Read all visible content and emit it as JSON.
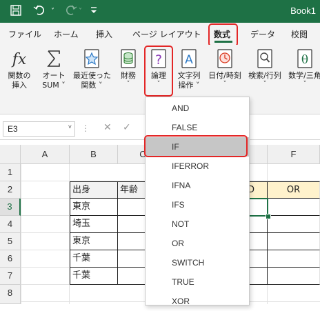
{
  "titlebar": {
    "title": "Book1",
    "save_icon": "save-icon",
    "undo_icon": "undo-icon",
    "redo_icon": "redo-icon",
    "customize_icon": "customize-qat-icon"
  },
  "menu": {
    "tabs": [
      "ファイル",
      "ホーム",
      "挿入",
      "ページ レイアウト",
      "数式",
      "データ",
      "校閲"
    ],
    "active": "数式"
  },
  "ribbon": {
    "buttons": [
      {
        "line1": "関数の",
        "line2": "挿入",
        "caret": "",
        "icon": "fx-icon"
      },
      {
        "line1": "オート",
        "line2": "SUM",
        "caret": "˅",
        "icon": "sigma-icon"
      },
      {
        "line1": "最近使った",
        "line2": "関数",
        "caret": "˅",
        "icon": "star-book-icon"
      },
      {
        "line1": "財務",
        "line2": "",
        "caret": "˅",
        "icon": "database-book-icon"
      },
      {
        "line1": "論理",
        "line2": "",
        "caret": "˅",
        "icon": "question-book-icon"
      },
      {
        "line1": "文字列",
        "line2": "操作",
        "caret": "˅",
        "icon": "text-book-icon"
      },
      {
        "line1": "日付/時刻",
        "line2": "",
        "caret": "˅",
        "icon": "clock-book-icon"
      },
      {
        "line1": "検索/行列",
        "line2": "",
        "caret": "˅",
        "icon": "search-book-icon"
      },
      {
        "line1": "数学/三角",
        "line2": "",
        "caret": "˅",
        "icon": "theta-book-icon"
      }
    ]
  },
  "formula_bar": {
    "name_box": "E3",
    "dots": "⋮",
    "cancel": "✕",
    "enter": "✓"
  },
  "sheet": {
    "columns": [
      "A",
      "B",
      "C",
      "D",
      "E",
      "F"
    ],
    "rows": [
      "1",
      "2",
      "3",
      "4",
      "5",
      "6",
      "7",
      "8"
    ],
    "header_row": {
      "b": "出身",
      "c": "年齢",
      "e": "D",
      "f": "OR"
    },
    "birthplaces": [
      "東京",
      "埼玉",
      "東京",
      "千葉",
      "千葉"
    ],
    "selected_cell": "E3"
  },
  "dropdown": {
    "items": [
      "AND",
      "FALSE",
      "IF",
      "IFERROR",
      "IFNA",
      "IFS",
      "NOT",
      "OR",
      "SWITCH",
      "TRUE",
      "XOR"
    ],
    "highlighted": "IF"
  },
  "colors": {
    "accent": "#1e7145",
    "callout": "#e32626",
    "or_fill": "#fff2cc",
    "menu_highlight": "#c6c6c6"
  }
}
